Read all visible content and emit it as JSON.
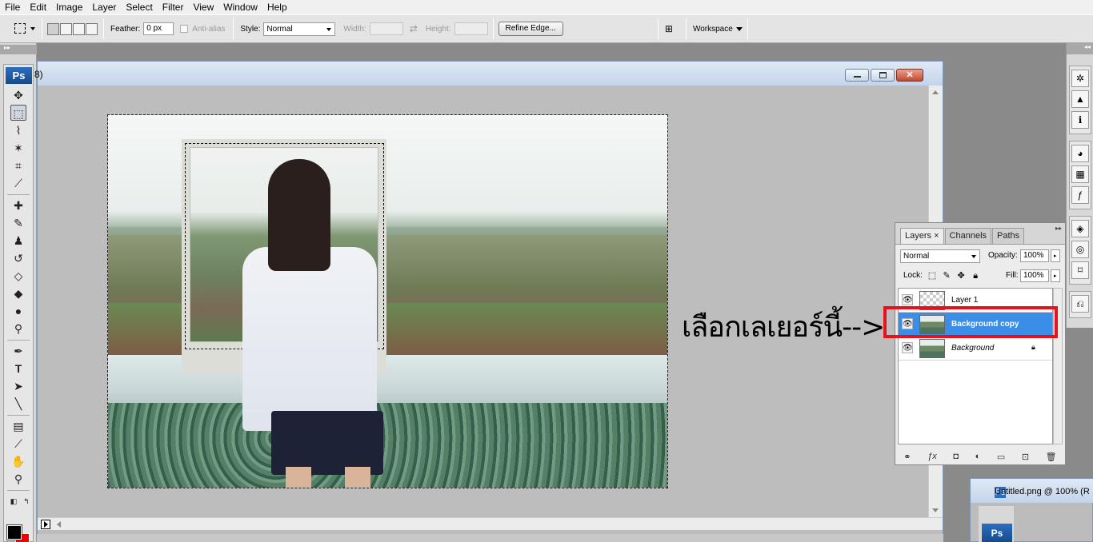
{
  "menu": [
    "File",
    "Edit",
    "Image",
    "Layer",
    "Select",
    "Filter",
    "View",
    "Window",
    "Help"
  ],
  "options": {
    "feather_label": "Feather:",
    "feather_value": "0 px",
    "antialias_label": "Anti-alias",
    "style_label": "Style:",
    "style_value": "Normal",
    "width_label": "Width:",
    "height_label": "Height:",
    "refine_edge": "Refine Edge...",
    "workspace": "Workspace"
  },
  "tools": {
    "logo": "Ps"
  },
  "document": {
    "title_fragment": "8)",
    "close_glyph": "✕"
  },
  "annotation": "เลือกเลเยอร์นี้-->",
  "layers_panel": {
    "tabs": [
      "Layers",
      "Channels",
      "Paths"
    ],
    "blend_mode": "Normal",
    "opacity_label": "Opacity:",
    "opacity_value": "100%",
    "lock_label": "Lock:",
    "fill_label": "Fill:",
    "fill_value": "100%",
    "layers": [
      {
        "name": "Layer 1",
        "active": false
      },
      {
        "name": "Background copy",
        "active": true
      },
      {
        "name": "Background",
        "active": false,
        "locked": true
      }
    ]
  },
  "second_window": {
    "title": "Untitled.png @ 100% (R",
    "logo": "Ps"
  },
  "colors": {
    "foreground": "#000000",
    "background": "#e00000",
    "highlight": "#e8101a",
    "selected_layer": "#3b8ee8"
  }
}
